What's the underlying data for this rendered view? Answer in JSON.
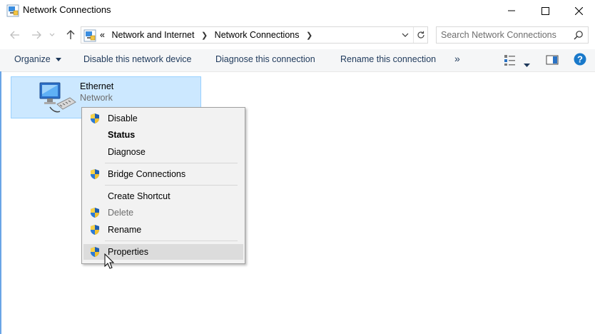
{
  "window": {
    "title": "Network Connections"
  },
  "address": {
    "overflow": "«",
    "crumbs": [
      "Network and Internet",
      "Network Connections"
    ]
  },
  "search": {
    "placeholder": "Search Network Connections"
  },
  "toolbar": {
    "organize": "Organize",
    "disable": "Disable this network device",
    "diagnose": "Diagnose this connection",
    "rename": "Rename this connection",
    "more": "»"
  },
  "connection": {
    "name": "Ethernet",
    "status": "Network"
  },
  "menu": {
    "items": [
      {
        "label": "Disable"
      },
      {
        "label": "Status"
      },
      {
        "label": "Diagnose"
      },
      {
        "label": "Bridge Connections"
      },
      {
        "label": "Create Shortcut"
      },
      {
        "label": "Delete"
      },
      {
        "label": "Rename"
      },
      {
        "label": "Properties"
      }
    ]
  },
  "colors": {
    "selection_bg": "#cce8ff",
    "selection_border": "#99d1ff",
    "link_text": "#1e395b",
    "help_blue": "#1979ca"
  }
}
